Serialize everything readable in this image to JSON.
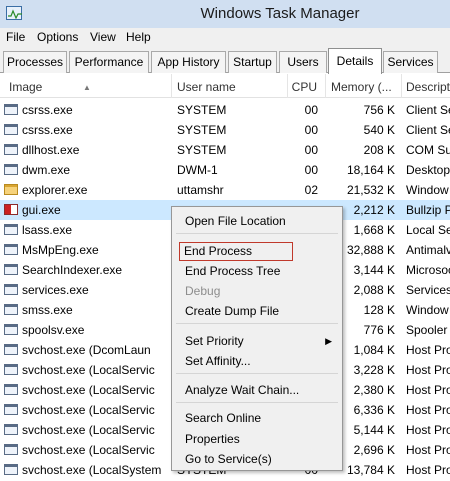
{
  "window": {
    "title": "Windows Task Manager",
    "icon": "task-manager-icon"
  },
  "menu": [
    "File",
    "Options",
    "View",
    "Help"
  ],
  "tabs": [
    "Processes",
    "Performance",
    "App History",
    "Startup",
    "Users",
    "Details",
    "Services"
  ],
  "active_tab": "Details",
  "columns": {
    "image": "Image",
    "user": "User name",
    "cpu": "CPU",
    "memory": "Memory (...",
    "description": "Descript"
  },
  "sort": {
    "column": "Image",
    "direction": "ascending"
  },
  "rows": [
    {
      "image": "csrss.exe",
      "user": "SYSTEM",
      "cpu": "00",
      "mem": "756 K",
      "desc": "Client Se",
      "icon": "process-icon"
    },
    {
      "image": "csrss.exe",
      "user": "SYSTEM",
      "cpu": "00",
      "mem": "540 K",
      "desc": "Client Se",
      "icon": "process-icon"
    },
    {
      "image": "dllhost.exe",
      "user": "SYSTEM",
      "cpu": "00",
      "mem": "208 K",
      "desc": "COM Sur",
      "icon": "process-icon"
    },
    {
      "image": "dwm.exe",
      "user": "DWM-1",
      "cpu": "00",
      "mem": "18,164 K",
      "desc": "Desktop",
      "icon": "process-icon"
    },
    {
      "image": "explorer.exe",
      "user": "uttamshr",
      "cpu": "02",
      "mem": "21,532 K",
      "desc": "Window",
      "icon": "explorer-folder-icon"
    },
    {
      "image": "gui.exe",
      "user": "",
      "cpu": "",
      "mem": "2,212 K",
      "desc": "Bullzip P",
      "icon": "gui-app-icon",
      "selected": true
    },
    {
      "image": "lsass.exe",
      "user": "",
      "cpu": "",
      "mem": "1,668 K",
      "desc": "Local Se",
      "icon": "process-icon"
    },
    {
      "image": "MsMpEng.exe",
      "user": "",
      "cpu": "",
      "mem": "32,888 K",
      "desc": "Antimalv",
      "icon": "process-icon"
    },
    {
      "image": "SearchIndexer.exe",
      "user": "",
      "cpu": "",
      "mem": "3,144 K",
      "desc": "Microsoc",
      "icon": "process-icon"
    },
    {
      "image": "services.exe",
      "user": "",
      "cpu": "",
      "mem": "2,088 K",
      "desc": "Services",
      "icon": "process-icon"
    },
    {
      "image": "smss.exe",
      "user": "",
      "cpu": "",
      "mem": "128 K",
      "desc": "Window",
      "icon": "process-icon"
    },
    {
      "image": "spoolsv.exe",
      "user": "",
      "cpu": "",
      "mem": "776 K",
      "desc": "Spooler",
      "icon": "process-icon"
    },
    {
      "image": "svchost.exe (DcomLaun",
      "user": "",
      "cpu": "",
      "mem": "1,084 K",
      "desc": "Host Pro",
      "icon": "process-icon"
    },
    {
      "image": "svchost.exe (LocalServic",
      "user": "",
      "cpu": "",
      "mem": "3,228 K",
      "desc": "Host Pro",
      "icon": "process-icon"
    },
    {
      "image": "svchost.exe (LocalServic",
      "user": "",
      "cpu": "",
      "mem": "2,380 K",
      "desc": "Host Pro",
      "icon": "process-icon"
    },
    {
      "image": "svchost.exe (LocalServic",
      "user": "",
      "cpu": "",
      "mem": "6,336 K",
      "desc": "Host Pro",
      "icon": "process-icon"
    },
    {
      "image": "svchost.exe (LocalServic",
      "user": "",
      "cpu": "",
      "mem": "5,144 K",
      "desc": "Host Pro",
      "icon": "process-icon"
    },
    {
      "image": "svchost.exe (LocalServic",
      "user": "",
      "cpu": "",
      "mem": "2,696 K",
      "desc": "Host Pro",
      "icon": "process-icon"
    },
    {
      "image": "svchost.exe (LocalSystem",
      "user": "SYSTEM",
      "cpu": "00",
      "mem": "13,784 K",
      "desc": "Host Pro",
      "icon": "process-icon"
    }
  ],
  "context_menu": {
    "items": [
      {
        "label": "Open File Location",
        "name": "menu-open-file-location"
      },
      {
        "sep": true
      },
      {
        "label": "End Process",
        "name": "menu-end-process",
        "highlighted": true
      },
      {
        "label": "End Process Tree",
        "name": "menu-end-process-tree"
      },
      {
        "label": "Debug",
        "name": "menu-debug",
        "disabled": true
      },
      {
        "label": "Create Dump File",
        "name": "menu-create-dump-file"
      },
      {
        "sep": true
      },
      {
        "label": "Set Priority",
        "name": "menu-set-priority",
        "submenu": true
      },
      {
        "label": "Set Affinity...",
        "name": "menu-set-affinity"
      },
      {
        "sep": true
      },
      {
        "label": "Analyze Wait Chain...",
        "name": "menu-analyze-wait-chain"
      },
      {
        "sep": true
      },
      {
        "label": "Search Online",
        "name": "menu-search-online"
      },
      {
        "label": "Properties",
        "name": "menu-properties"
      },
      {
        "label": "Go to Service(s)",
        "name": "menu-go-to-services"
      }
    ]
  },
  "colors": {
    "titlebar": "#d0dff1",
    "selected_row": "#cce8ff",
    "highlight_box": "#c0392b"
  }
}
